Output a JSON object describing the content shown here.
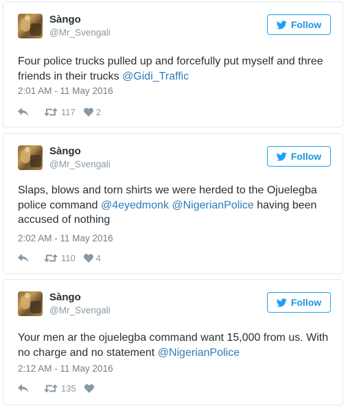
{
  "colors": {
    "accent": "#1da1f2",
    "link": "#2b7bb9",
    "muted": "#8899a6",
    "text": "#292f33"
  },
  "tweets": [
    {
      "display_name": "Sàngo",
      "handle": "@Mr_Svengali",
      "follow_label": "Follow",
      "text_parts": [
        "Four police trucks pulled up and forcefully put myself and three friends in their trucks ",
        "@Gidi_Traffic",
        ""
      ],
      "time": "2:01 AM - 11 May 2016",
      "retweets": "117",
      "likes": "2"
    },
    {
      "display_name": "Sàngo",
      "handle": "@Mr_Svengali",
      "follow_label": "Follow",
      "text_parts": [
        "Slaps, blows and torn shirts we were herded to the Ojuelegba police command ",
        "@4eyedmonk",
        " ",
        "@NigerianPolice",
        " having been accused of nothing"
      ],
      "time": "2:02 AM - 11 May 2016",
      "retweets": "110",
      "likes": "4"
    },
    {
      "display_name": "Sàngo",
      "handle": "@Mr_Svengali",
      "follow_label": "Follow",
      "text_parts": [
        "Your men ar the ojuelegba command want 15,000 from us. With no charge and no statement ",
        "@NigerianPolice"
      ],
      "time": "2:12 AM - 11 May 2016",
      "retweets": "135",
      "likes": ""
    }
  ]
}
